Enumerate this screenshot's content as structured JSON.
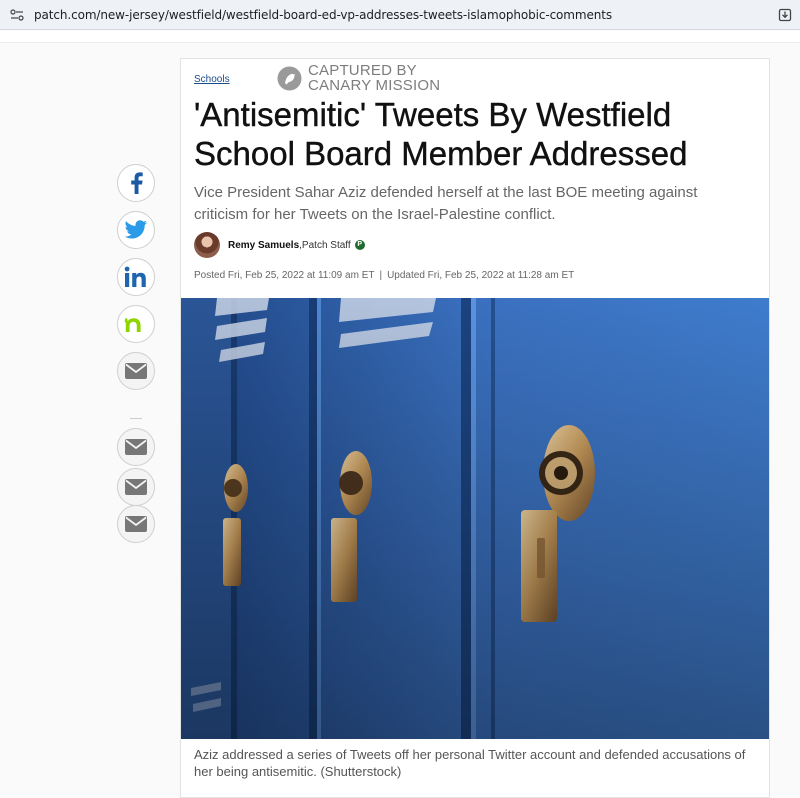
{
  "browser": {
    "url": "patch.com/new-jersey/westfield/westfield-board-ed-vp-addresses-tweets-islamophobic-comments",
    "icons": [
      "site-settings-icon",
      "download-icon"
    ]
  },
  "article": {
    "section": "Schools",
    "watermark_line1": "CAPTURED BY",
    "watermark_line2": "CANARY MISSION",
    "headline": "'Antisemitic' Tweets By Westfield School Board Member Addressed",
    "dek": "Vice President Sahar Aziz defended herself at the last BOE meeting against criticism for her Tweets on the Israel-Palestine conflict.",
    "author": "Remy Samuels",
    "author_role": ",Patch Staff",
    "badge": "P",
    "posted": "Posted Fri, Feb 25, 2022 at 11:09 am ET",
    "separator": "|",
    "updated": "Updated Fri, Feb 25, 2022 at 11:28 am ET",
    "caption": "Aziz addressed a series of Tweets off her personal Twitter account and defended accusations of her being antisemitic. (Shutterstock)"
  },
  "share_icons": [
    "facebook-icon",
    "twitter-icon",
    "linkedin-icon",
    "nextdoor-icon",
    "email-icon",
    "email-icon",
    "email-icon",
    "email-icon"
  ],
  "colors": {
    "facebook": "#1d5aa6",
    "twitter": "#2a9be8",
    "linkedin": "#1f66b0",
    "nextdoor": "#8ed500",
    "email": "#777777",
    "badge": "#1f6b2e",
    "locker_blue": "#2c5aa0"
  }
}
